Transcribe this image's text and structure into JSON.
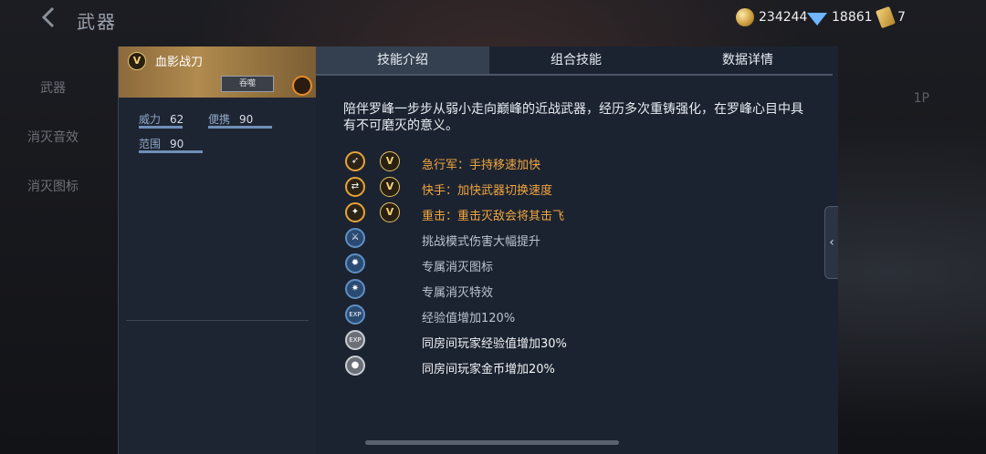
{
  "header": {
    "back_icon": "chevron-left-icon",
    "title": "武器"
  },
  "currency": {
    "gold": "234244",
    "diamond": "18861",
    "ticket": "7"
  },
  "left_nav": {
    "items": [
      "武器",
      "消灭音效",
      "消灭图标"
    ]
  },
  "right_deco": {
    "label": "1P"
  },
  "weapon": {
    "badge": "V",
    "name": "血影战刀",
    "rank_chip": "吞噬",
    "stats": [
      {
        "label": "威力",
        "value": "62"
      },
      {
        "label": "便携",
        "value": "90"
      },
      {
        "label": "范围",
        "value": "90"
      }
    ]
  },
  "tabs": [
    {
      "label": "技能介绍",
      "active": true
    },
    {
      "label": "组合技能",
      "active": false
    },
    {
      "label": "数据详情",
      "active": false
    }
  ],
  "description": "陪伴罗峰一步步从弱小走向巅峰的近战武器，经历多次重铸强化，在罗峰心目中具有不可磨灭的意义。",
  "skills": [
    {
      "icon": "running-icon",
      "v_badge": "V",
      "text": "急行军：手持移速加快",
      "color": "#f0a640"
    },
    {
      "icon": "swap-hand-icon",
      "v_badge": "V",
      "text": "快手：加快武器切换速度",
      "color": "#f0a640"
    },
    {
      "icon": "heavy-hit-icon",
      "v_badge": "V",
      "text": "重击：重击灭敌会将其击飞",
      "color": "#f0a640"
    },
    {
      "icon": "challenge-damage-icon",
      "text": "挑战模式伤害大幅提升",
      "color": "#b9c3d2"
    },
    {
      "icon": "kill-icon-icon",
      "text": "专属消灭图标",
      "color": "#b9c3d2"
    },
    {
      "icon": "kill-effect-icon",
      "text": "专属消灭特效",
      "color": "#b9c3d2"
    },
    {
      "icon": "exp-icon",
      "text": "经验值增加120%",
      "color": "#b9c3d2"
    },
    {
      "icon": "room-exp-icon",
      "text": "同房间玩家经验值增加30%",
      "color": "#f0f2f5"
    },
    {
      "icon": "room-gold-icon",
      "text": "同房间玩家金币增加20%",
      "color": "#f0f2f5"
    }
  ]
}
